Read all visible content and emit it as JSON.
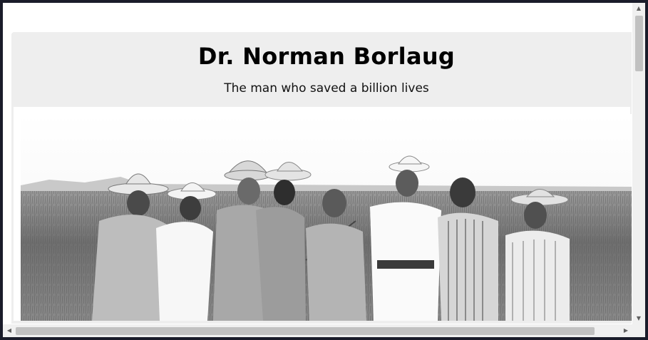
{
  "hero": {
    "title": "Dr. Norman Borlaug",
    "subtitle": "The man who saved a billion lives"
  },
  "photo": {
    "description_icon": "photo-icon",
    "style": "black-and-white"
  },
  "scrollbars": {
    "vertical": {
      "up_icon": "chevron-up-icon",
      "down_icon": "chevron-down-icon",
      "position": 0.0
    },
    "horizontal": {
      "left_icon": "chevron-left-icon",
      "right_icon": "chevron-right-icon",
      "position": 0.0
    }
  },
  "colors": {
    "window_border": "#1a1c2a",
    "card_bg": "#eeeeee",
    "page_bg": "#ffffff",
    "scroll_track": "#f0f0f0",
    "scroll_thumb": "#c1c1c1"
  }
}
